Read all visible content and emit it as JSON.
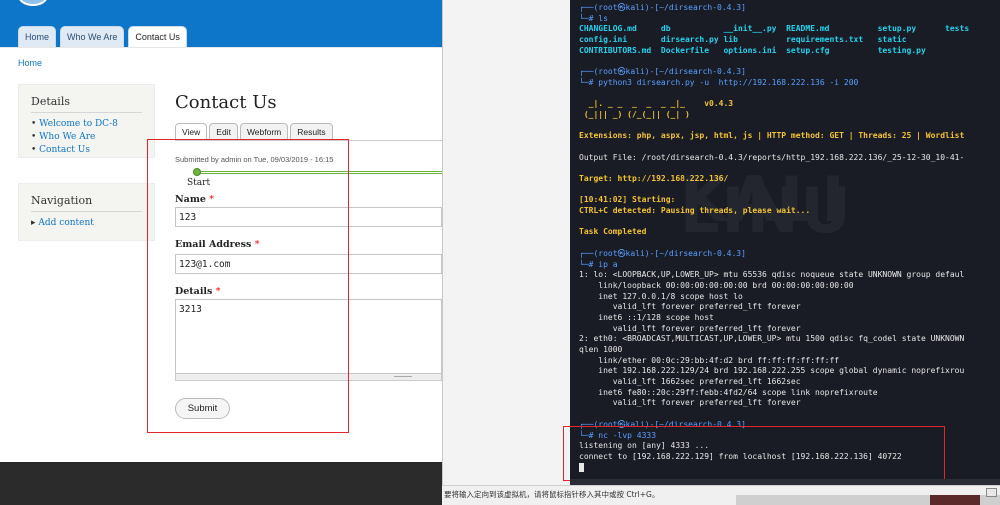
{
  "site": {
    "nav_tabs": [
      "Home",
      "Who We Are",
      "Contact Us"
    ],
    "breadcrumb": "Home",
    "details_block": {
      "title": "Details",
      "links": [
        "Welcome to DC-8",
        "Who We Are",
        "Contact Us"
      ]
    },
    "navigation_block": {
      "title": "Navigation",
      "links": [
        "Add content"
      ]
    },
    "page_title": "Contact Us",
    "view_tabs": [
      "View",
      "Edit",
      "Webform",
      "Results"
    ],
    "submitted": "Submitted by admin on Tue, 09/03/2019 - 16:15",
    "progress_start": "Start",
    "fields": {
      "name_label": "Name",
      "name_value": "123",
      "email_label": "Email Address",
      "email_value": "123@1.com",
      "details_label": "Details",
      "details_value": "3213",
      "required_mark": "*"
    },
    "submit_label": "Submit"
  },
  "terminal": {
    "watermark": "KALI LINU",
    "lines": [
      {
        "c": "c-blue",
        "t": "┌──(root㉿kali)-[~/dirsearch-0.4.3]"
      },
      {
        "c": "c-blue",
        "t": "└─# ls"
      },
      {
        "c": "c-teal",
        "t": "CHANGELOG.md     db           __init__.py  README.md          setup.py      tests"
      },
      {
        "c": "c-teal",
        "t": "config.ini       dirsearch.py lib          requirements.txt   static"
      },
      {
        "c": "c-teal",
        "t": "CONTRIBUTORS.md  Dockerfile   options.ini  setup.cfg          testing.py"
      },
      {
        "c": "",
        "t": ""
      },
      {
        "c": "c-blue",
        "t": "┌──(root㉿kali)-[~/dirsearch-0.4.3]"
      },
      {
        "c": "c-blue",
        "t": "└─# python3 dirsearch.py -u  http://192.168.222.136 -i 200"
      },
      {
        "c": "",
        "t": ""
      },
      {
        "c": "c-yel",
        "t": "  _|. _ _  _  _  _ _|_    v0.4.3"
      },
      {
        "c": "c-yel",
        "t": " (_||| _) (/_(_|| (_| )"
      },
      {
        "c": "",
        "t": ""
      },
      {
        "c": "c-yel",
        "t": "Extensions: php, aspx, jsp, html, js | HTTP method: GET | Threads: 25 | Wordlist"
      },
      {
        "c": "",
        "t": ""
      },
      {
        "c": "",
        "t": "Output File: /root/dirsearch-0.4.3/reports/http_192.168.222.136/_25-12-30_10-41-"
      },
      {
        "c": "",
        "t": ""
      },
      {
        "c": "c-yel",
        "t": "Target: http://192.168.222.136/"
      },
      {
        "c": "",
        "t": ""
      },
      {
        "c": "c-yel",
        "t": "[10:41:02] Starting:"
      },
      {
        "c": "c-yel",
        "t": "CTRL+C detected: Pausing threads, please wait..."
      },
      {
        "c": "",
        "t": ""
      },
      {
        "c": "c-yel",
        "t": "Task Completed"
      },
      {
        "c": "",
        "t": ""
      },
      {
        "c": "c-blue",
        "t": "┌──(root㉿kali)-[~/dirsearch-0.4.3]"
      },
      {
        "c": "c-blue",
        "t": "└─# ip a"
      },
      {
        "c": "",
        "t": "1: lo: <LOOPBACK,UP,LOWER_UP> mtu 65536 qdisc noqueue state UNKNOWN group defaul"
      },
      {
        "c": "",
        "t": "    link/loopback 00:00:00:00:00:00 brd 00:00:00:00:00:00"
      },
      {
        "c": "",
        "t": "    inet 127.0.0.1/8 scope host lo"
      },
      {
        "c": "",
        "t": "       valid_lft forever preferred_lft forever"
      },
      {
        "c": "",
        "t": "    inet6 ::1/128 scope host"
      },
      {
        "c": "",
        "t": "       valid_lft forever preferred_lft forever"
      },
      {
        "c": "",
        "t": "2: eth0: <BROADCAST,MULTICAST,UP,LOWER_UP> mtu 1500 qdisc fq_codel state UNKNOWN"
      },
      {
        "c": "",
        "t": "qlen 1000"
      },
      {
        "c": "",
        "t": "    link/ether 00:0c:29:bb:4f:d2 brd ff:ff:ff:ff:ff:ff"
      },
      {
        "c": "",
        "t": "    inet 192.168.222.129/24 brd 192.168.222.255 scope global dynamic noprefixrou"
      },
      {
        "c": "",
        "t": "       valid_lft 1662sec preferred_lft 1662sec"
      },
      {
        "c": "",
        "t": "    inet6 fe80::20c:29ff:febb:4fd2/64 scope link noprefixroute"
      },
      {
        "c": "",
        "t": "       valid_lft forever preferred_lft forever"
      },
      {
        "c": "",
        "t": ""
      },
      {
        "c": "c-blue",
        "t": "┌──(root㉿kali)-[~/dirsearch-0.4.3]"
      },
      {
        "c": "c-blue",
        "t": "└─# nc -lvp 4333"
      },
      {
        "c": "",
        "t": "listening on [any] 4333 ..."
      },
      {
        "c": "",
        "t": "connect to [192.168.222.129] from localhost [192.168.222.136] 40722"
      }
    ]
  },
  "status_bar": {
    "hint": "要将输入定向到该虚拟机，请将鼠标指针移入其中或按 Ctrl+G。"
  }
}
